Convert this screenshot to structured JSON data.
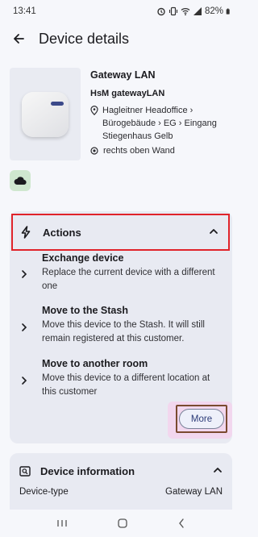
{
  "status_bar": {
    "time": "13:41",
    "battery": "82%",
    "icons": [
      "alarm-icon",
      "vibrate-icon",
      "wifi-icon",
      "signal-icon",
      "battery-icon"
    ]
  },
  "app_bar": {
    "title": "Device details",
    "back_icon": "arrow-left-icon"
  },
  "device": {
    "name": "Gateway LAN",
    "model": "HsM gatewayLAN",
    "location": "Hagleitner Headoffice › Bürogebäude › EG › Eingang Stiegenhaus Gelb",
    "position": "rechts oben Wand",
    "status_icon": "cloud-icon",
    "status_color": "#cfe7cf"
  },
  "actions": {
    "title": "Actions",
    "items": [
      {
        "title": "Exchange device",
        "description": "Replace the current device with a different one"
      },
      {
        "title": "Move to the Stash",
        "description": "Move this device to the Stash. It will still remain registered at this customer."
      },
      {
        "title": "Move to another room",
        "description": "Move this device to a different location at this customer"
      }
    ],
    "more_label": "More"
  },
  "device_information": {
    "title": "Device information",
    "rows": [
      {
        "label": "Device-type",
        "value": "Gateway LAN"
      }
    ]
  },
  "colors": {
    "highlight_red": "#e0232a",
    "highlight_brown": "#7a4a2f",
    "card_background": "#e8eaf2",
    "more_highlight": "#f2d7ee"
  }
}
